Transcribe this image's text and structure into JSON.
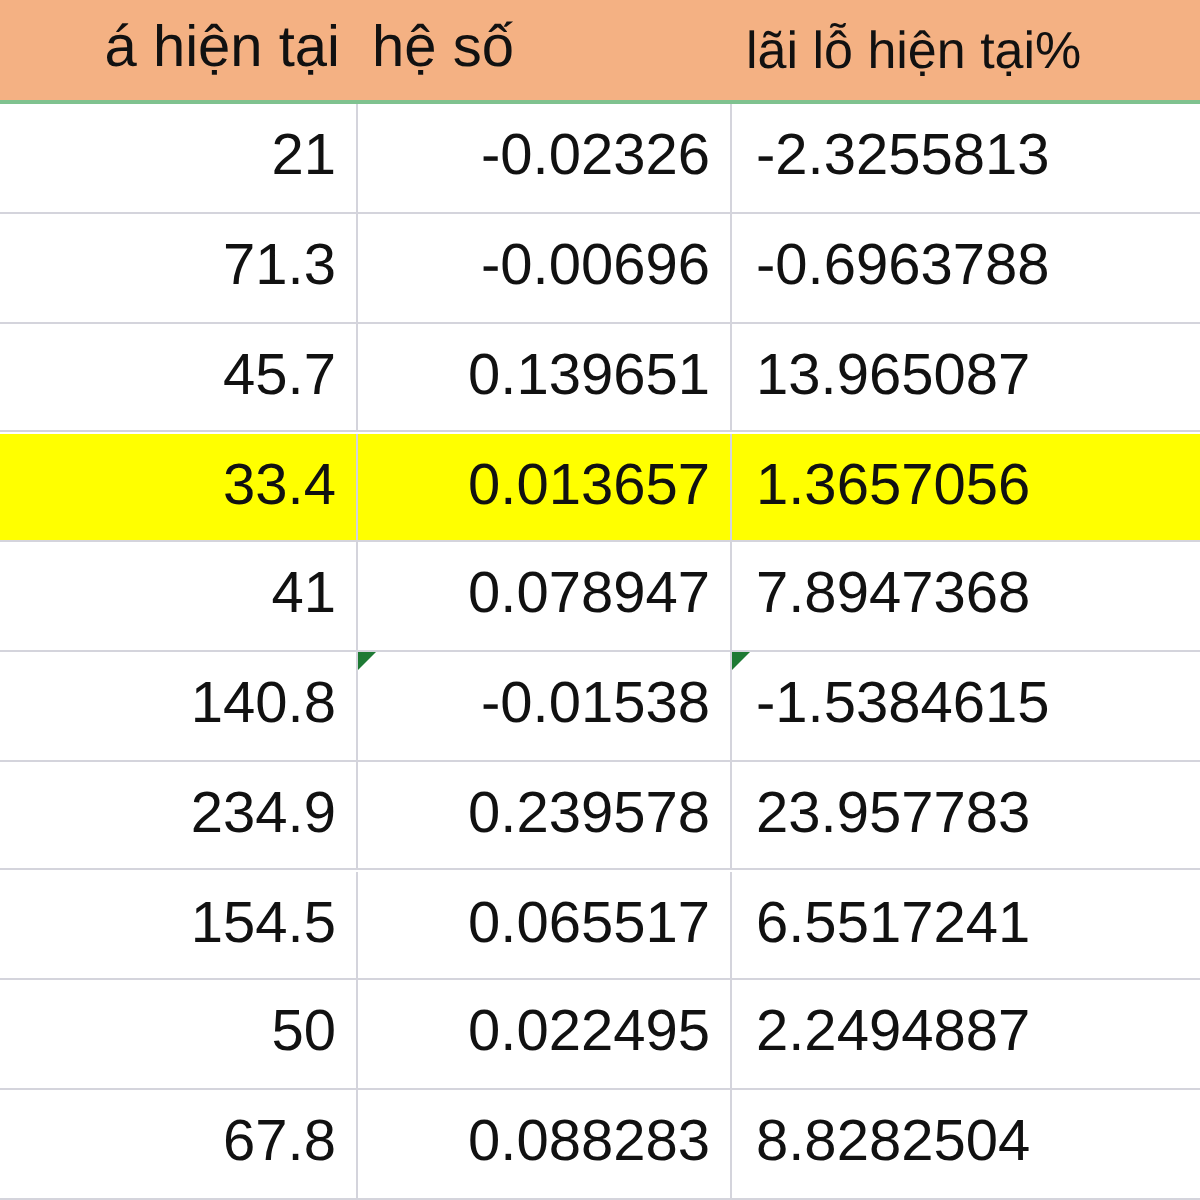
{
  "header": [
    "á hiện tại",
    "hệ số",
    "lãi lỗ hiện tại%"
  ],
  "rows": [
    {
      "highlighted": false,
      "cells": [
        {
          "text": "21",
          "error_flag": false
        },
        {
          "text": "-0.02326",
          "error_flag": false
        },
        {
          "text": "-2.3255813",
          "error_flag": false
        }
      ]
    },
    {
      "highlighted": false,
      "cells": [
        {
          "text": "71.3",
          "error_flag": false
        },
        {
          "text": "-0.00696",
          "error_flag": false
        },
        {
          "text": "-0.6963788",
          "error_flag": false
        }
      ]
    },
    {
      "highlighted": false,
      "cells": [
        {
          "text": "45.7",
          "error_flag": false
        },
        {
          "text": "0.139651",
          "error_flag": false
        },
        {
          "text": "13.965087",
          "error_flag": false
        }
      ]
    },
    {
      "highlighted": true,
      "cells": [
        {
          "text": "33.4",
          "error_flag": false
        },
        {
          "text": "0.013657",
          "error_flag": false
        },
        {
          "text": "1.3657056",
          "error_flag": false
        }
      ]
    },
    {
      "highlighted": false,
      "cells": [
        {
          "text": "41",
          "error_flag": false
        },
        {
          "text": "0.078947",
          "error_flag": false
        },
        {
          "text": "7.8947368",
          "error_flag": false
        }
      ]
    },
    {
      "highlighted": false,
      "cells": [
        {
          "text": "140.8",
          "error_flag": false
        },
        {
          "text": "-0.01538",
          "error_flag": true
        },
        {
          "text": "-1.5384615",
          "error_flag": true
        }
      ]
    },
    {
      "highlighted": false,
      "cells": [
        {
          "text": "234.9",
          "error_flag": false
        },
        {
          "text": "0.239578",
          "error_flag": false
        },
        {
          "text": "23.957783",
          "error_flag": false
        }
      ]
    },
    {
      "highlighted": false,
      "cells": [
        {
          "text": "154.5",
          "error_flag": false
        },
        {
          "text": "0.065517",
          "error_flag": false
        },
        {
          "text": "6.5517241",
          "error_flag": false
        }
      ]
    },
    {
      "highlighted": false,
      "cells": [
        {
          "text": "50",
          "error_flag": false
        },
        {
          "text": "0.022495",
          "error_flag": false
        },
        {
          "text": "2.2494887",
          "error_flag": false
        }
      ]
    },
    {
      "highlighted": false,
      "cells": [
        {
          "text": "67.8",
          "error_flag": false
        },
        {
          "text": "0.088283",
          "error_flag": false
        },
        {
          "text": "8.8282504",
          "error_flag": false
        }
      ]
    }
  ]
}
